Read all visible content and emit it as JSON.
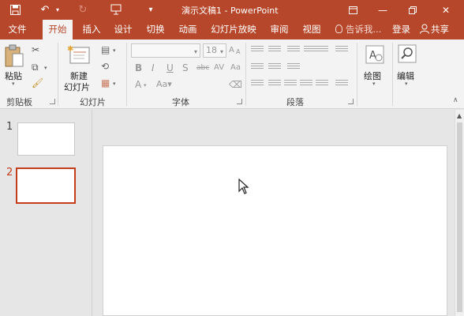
{
  "titlebar": {
    "title": "演示文稿1 - PowerPoint",
    "icons": [
      "save-icon",
      "undo-icon",
      "redo-icon",
      "present-icon",
      "customize-icon"
    ],
    "window_controls": [
      "ribbon-display-options",
      "minimize",
      "restore",
      "close"
    ]
  },
  "tabs": [
    {
      "label": "文件"
    },
    {
      "label": "开始",
      "active": true
    },
    {
      "label": "插入"
    },
    {
      "label": "设计"
    },
    {
      "label": "切换"
    },
    {
      "label": "动画"
    },
    {
      "label": "幻灯片放映"
    },
    {
      "label": "审阅"
    },
    {
      "label": "视图"
    }
  ],
  "tell_me": "告诉我...",
  "sign_in": "登录",
  "share": "共享",
  "ribbon": {
    "clipboard": {
      "paste": "粘贴",
      "label": "剪贴板"
    },
    "slides": {
      "new_slide_line1": "新建",
      "new_slide_line2": "幻灯片",
      "label": "幻灯片"
    },
    "font": {
      "size": "18",
      "label": "字体"
    },
    "paragraph": {
      "label": "段落"
    },
    "drawing": {
      "label": "绘图"
    },
    "editing": {
      "label": "编辑"
    }
  },
  "slides_panel": {
    "items": [
      {
        "number": "1",
        "selected": false
      },
      {
        "number": "2",
        "selected": true
      }
    ]
  },
  "colors": {
    "accent": "#b7472a",
    "selected_border": "#c43e1c"
  }
}
